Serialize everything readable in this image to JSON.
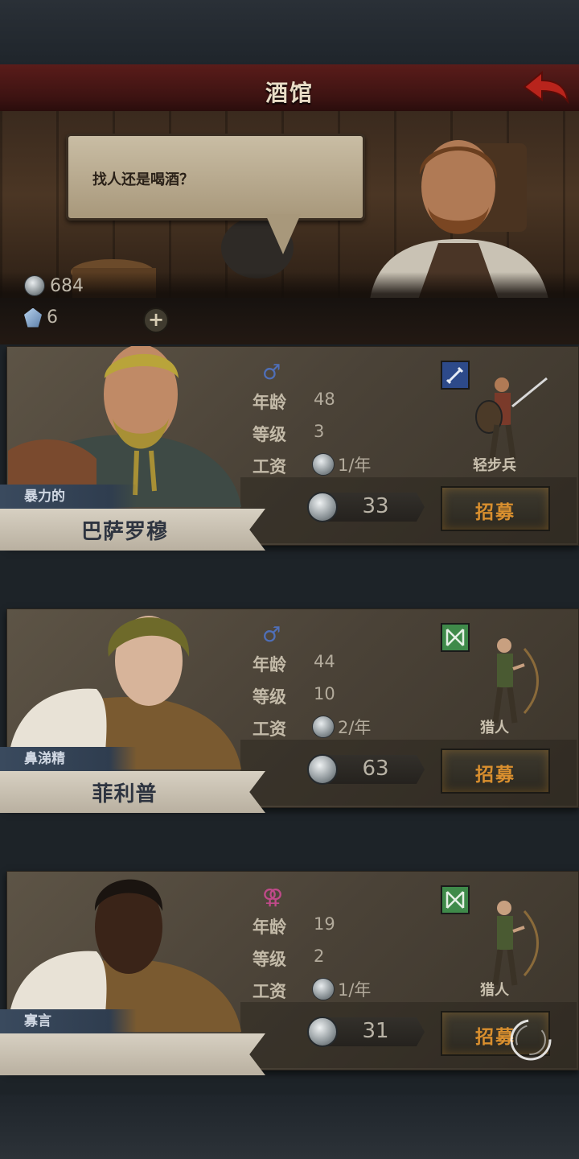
{
  "header": {
    "title": "酒馆",
    "back_icon": "back-arrow-icon"
  },
  "npc": {
    "speech": "找人还是喝酒？"
  },
  "currency": {
    "silver": "684",
    "gems": "6"
  },
  "recruits": [
    {
      "trait": "暴力的",
      "name": "巴萨罗穆",
      "gender_symbol": "♂",
      "gender_color": "#4f6fb8",
      "age_label": "年龄",
      "age": "48",
      "level_label": "等级",
      "level": "3",
      "wage_label": "工资",
      "wage": "1/年",
      "class_icon": "sword-icon",
      "class_name": "轻步兵",
      "price": "33",
      "recruit_label": "招募"
    },
    {
      "trait": "鼻涕精",
      "name": "菲利普",
      "gender_symbol": "♂",
      "gender_color": "#4f6fb8",
      "age_label": "年龄",
      "age": "44",
      "level_label": "等级",
      "level": "10",
      "wage_label": "工资",
      "wage": "2/年",
      "class_icon": "bow-icon",
      "class_name": "猎人",
      "price": "63",
      "recruit_label": "招募"
    },
    {
      "trait": "寡言",
      "name": "",
      "gender_symbol": "⚢",
      "gender_color": "#c04a8a",
      "age_label": "年龄",
      "age": "19",
      "level_label": "等级",
      "level": "2",
      "wage_label": "工资",
      "wage": "1/年",
      "class_icon": "bow-icon",
      "class_name": "猎人",
      "price": "31",
      "recruit_label": "招募"
    }
  ]
}
